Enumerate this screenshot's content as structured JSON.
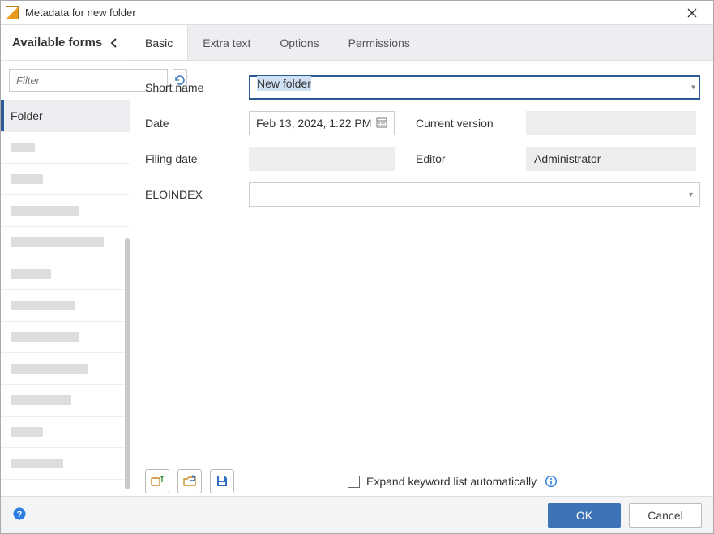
{
  "window": {
    "title": "Metadata for new folder"
  },
  "sidebar": {
    "heading": "Available forms",
    "filter_placeholder": "Filter",
    "items": [
      {
        "label": "Folder",
        "selected": true
      },
      {
        "label": ""
      },
      {
        "label": ""
      },
      {
        "label": ""
      },
      {
        "label": ""
      },
      {
        "label": ""
      },
      {
        "label": ""
      },
      {
        "label": ""
      },
      {
        "label": ""
      },
      {
        "label": ""
      },
      {
        "label": ""
      },
      {
        "label": ""
      }
    ]
  },
  "tabs": [
    {
      "id": "basic",
      "label": "Basic",
      "active": true
    },
    {
      "id": "extra",
      "label": "Extra text",
      "active": false
    },
    {
      "id": "options",
      "label": "Options",
      "active": false
    },
    {
      "id": "permissions",
      "label": "Permissions",
      "active": false
    }
  ],
  "form": {
    "labels": {
      "short_name": "Short name",
      "date": "Date",
      "current_version": "Current version",
      "filing_date": "Filing date",
      "editor": "Editor",
      "eloindex": "ELOINDEX"
    },
    "short_name": "New folder",
    "date": "Feb 13, 2024, 1:22 PM",
    "current_version": "",
    "filing_date": "",
    "editor": "Administrator",
    "eloindex": ""
  },
  "toolbar": {
    "expand_label": "Expand keyword list automatically",
    "expand_checked": false
  },
  "footer": {
    "ok": "OK",
    "cancel": "Cancel"
  }
}
